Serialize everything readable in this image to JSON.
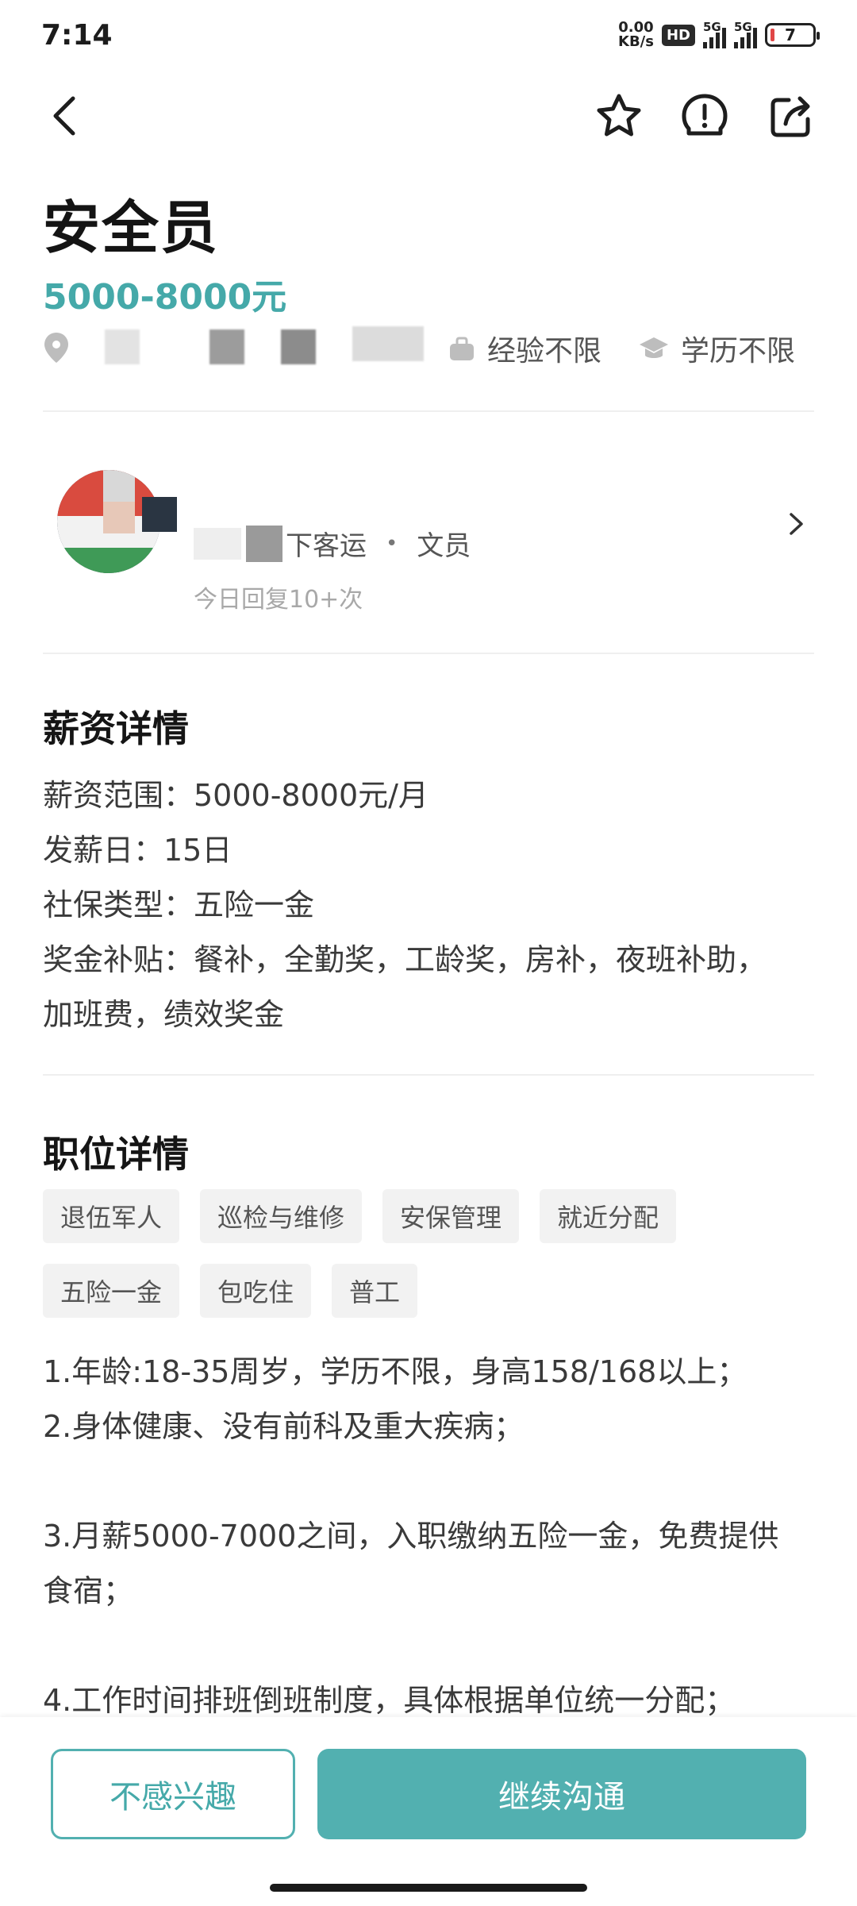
{
  "status_bar": {
    "time": "7:14",
    "net_speed_value": "0.00",
    "net_speed_unit": "KB/s",
    "hd": "HD",
    "signal_1_label": "5G",
    "signal_2_label": "5G",
    "battery": "7"
  },
  "job": {
    "title": "安全员",
    "salary": "5000-8000元",
    "experience": "经验不限",
    "education": "学历不限"
  },
  "recruiter": {
    "company_suffix": "下客运",
    "role": "文员",
    "dot": "•",
    "reply": "今日回复10+次"
  },
  "salary_section": {
    "title": "薪资详情",
    "lines": [
      "薪资范围：5000-8000元/月",
      "发薪日：15日",
      "社保类型：五险一金",
      "奖金补贴：餐补，全勤奖，工龄奖，房补，夜班补助，",
      "加班费，绩效奖金"
    ]
  },
  "position_section": {
    "title": "职位详情",
    "tags": [
      "退伍军人",
      "巡检与维修",
      "安保管理",
      "就近分配",
      "五险一金",
      "包吃住",
      "普工"
    ],
    "description": [
      "1.年龄:18-35周岁，学历不限，身高158/168以上；",
      "2.身体健康、没有前科及重大疾病；",
      "",
      "3.月薪5000-7000之间，入职缴纳五险一金，免费提供",
      "食宿；",
      "",
      "4.工作时间排班倒班制度，具体根据单位统一分配；"
    ]
  },
  "actions": {
    "not_interested": "不感兴趣",
    "continue_chat": "继续沟通"
  },
  "colors": {
    "accent": "#52b0b0",
    "salary_text": "#45a9a9"
  }
}
